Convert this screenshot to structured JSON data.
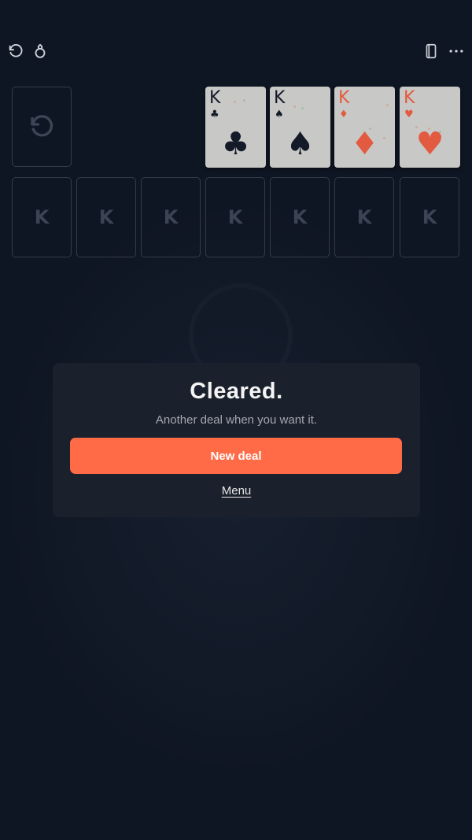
{
  "toolbar": {
    "left_icons": [
      "undo-icon",
      "hint-icon"
    ],
    "right_icons": [
      "cards-icon",
      "more-icon"
    ]
  },
  "stock": {
    "icon": "redeal-icon"
  },
  "foundations": [
    {
      "rank": "K",
      "suit": "♣",
      "suit_name": "clubs",
      "color": "#141a28"
    },
    {
      "rank": "K",
      "suit": "♠",
      "suit_name": "spades",
      "color": "#141a28"
    },
    {
      "rank": "K",
      "suit": "♦",
      "suit_name": "diamonds",
      "color": "#e25b40"
    },
    {
      "rank": "K",
      "suit": "♥",
      "suit_name": "hearts",
      "color": "#e25b40"
    }
  ],
  "tableau": [
    "K",
    "K",
    "K",
    "K",
    "K",
    "K",
    "K"
  ],
  "dialog": {
    "title": "Cleared.",
    "subtitle": "Another deal when you want it.",
    "new_deal_label": "New deal",
    "menu_label": "Menu"
  },
  "colors": {
    "background": "#0f1623",
    "accent": "#ff6b47",
    "panel": "#1a202c",
    "card_face": "#c8c8c6"
  }
}
